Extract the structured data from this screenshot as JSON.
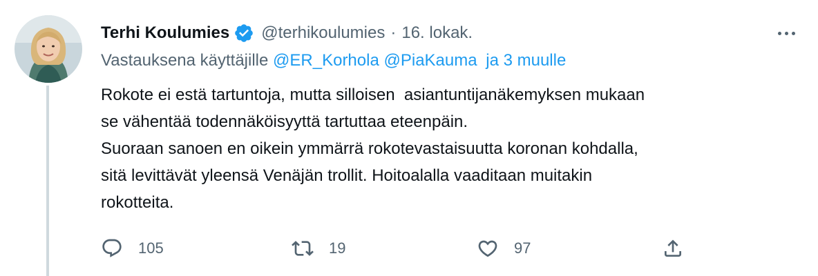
{
  "tweet": {
    "author_name": "Terhi Koulumies",
    "handle": "@terhikoulumies",
    "separator": "·",
    "date": "16. lokak.",
    "reply_prefix": "Vastauksena käyttäjille",
    "reply_mentions": [
      "@ER_Korhola",
      "@PiaKauma"
    ],
    "reply_suffix": "ja 3 muulle",
    "text_lines": [
      "Rokote ei estä tartuntoja, mutta silloisen  asiantuntijanäkemyksen mukaan",
      "se vähentää todennäköisyyttä tartuttaa eteenpäin.",
      "Suoraan sanoen en oikein ymmärrä rokotevastaisuutta koronan kohdalla,",
      "sitä levittävät yleensä Venäjän trollit. Hoitoalalla vaaditaan muitakin",
      "rokotteita."
    ]
  },
  "actions": {
    "replies": "105",
    "retweets": "19",
    "likes": "97"
  },
  "icons": {
    "avatar": "avatar-photo",
    "verified": "verified-badge-icon",
    "more": "more-options-icon",
    "reply": "reply-icon",
    "retweet": "retweet-icon",
    "like": "heart-icon",
    "share": "share-icon"
  },
  "colors": {
    "link": "#1d9bf0",
    "secondary_text": "#536471",
    "primary_text": "#0f1419",
    "thread_line": "#cfd9de",
    "verified": "#1d9bf0"
  }
}
